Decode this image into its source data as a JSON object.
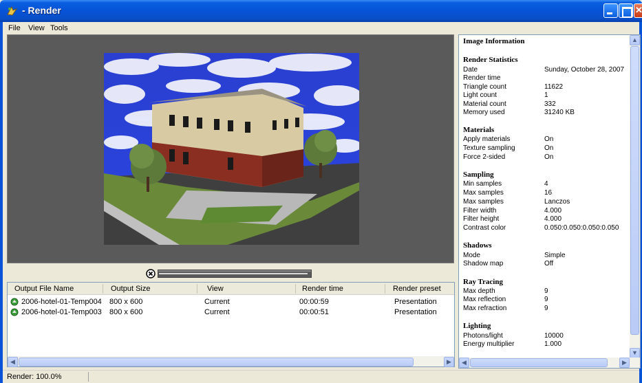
{
  "window": {
    "title": "- Render"
  },
  "menu": {
    "items": [
      "File",
      "View",
      "Tools"
    ]
  },
  "render_progress": 0.98,
  "table": {
    "columns": [
      "Output File Name",
      "Output Size",
      "View",
      "Render time",
      "Render preset"
    ],
    "rows": [
      {
        "name": "2006-hotel-01-Temp004",
        "size": "800 x 600",
        "view": "Current",
        "time": "00:00:59",
        "preset": "Presentation"
      },
      {
        "name": "2006-hotel-01-Temp003",
        "size": "800 x 600",
        "view": "Current",
        "time": "00:00:51",
        "preset": "Presentation"
      }
    ]
  },
  "info": {
    "title": "Image Information",
    "stats": {
      "heading": "Render Statistics",
      "date_label": "Date",
      "date_value": "Sunday, October 28, 2007",
      "render_time_label": "Render time",
      "triangle_label": "Triangle count",
      "triangle_value": "11622",
      "light_label": "Light count",
      "light_value": "1",
      "material_label": "Material count",
      "material_value": "332",
      "memory_label": "Memory used",
      "memory_value": "31240 KB"
    },
    "materials": {
      "heading": "Materials",
      "apply_label": "Apply materials",
      "apply_value": "On",
      "texture_label": "Texture sampling",
      "texture_value": "On",
      "force_label": "Force 2-sided",
      "force_value": "On"
    },
    "sampling": {
      "heading": "Sampling",
      "min_label": "Min samples",
      "min_value": "4",
      "max_label": "Max samples",
      "max_value": "16",
      "max2_label": "Max samples",
      "max2_value": "Lanczos",
      "fw_label": "Filter width",
      "fw_value": "4.000",
      "fh_label": "Filter height",
      "fh_value": "4.000",
      "cc_label": "Contrast color",
      "cc_value": "0.050:0.050:0.050:0.050"
    },
    "shadows": {
      "heading": "Shadows",
      "mode_label": "Mode",
      "mode_value": "Simple",
      "map_label": "Shadow map",
      "map_value": "Off"
    },
    "raytracing": {
      "heading": "Ray Tracing",
      "depth_label": "Max depth",
      "depth_value": "9",
      "reflection_label": "Max reflection",
      "reflection_value": "9",
      "refraction_label": "Max refraction",
      "refraction_value": "9"
    },
    "lighting": {
      "heading": "Lighting",
      "photons_label": "Photons/light",
      "photons_value": "10000",
      "energy_label": "Energy multiplier",
      "energy_value": "1.000"
    }
  },
  "status": {
    "text": "Render: 100.0%"
  }
}
